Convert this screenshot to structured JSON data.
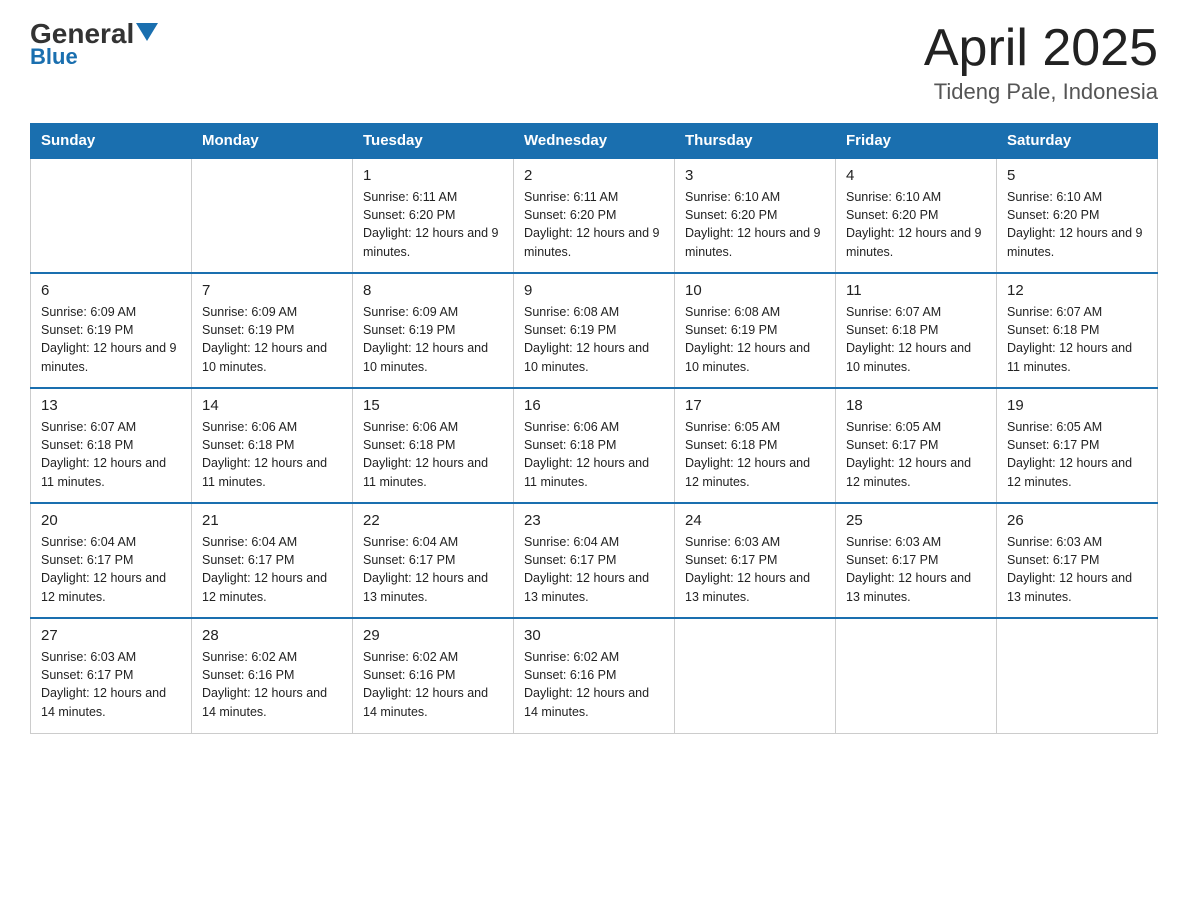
{
  "header": {
    "logo_general": "General",
    "logo_blue": "Blue",
    "month_title": "April 2025",
    "location": "Tideng Pale, Indonesia"
  },
  "columns": [
    "Sunday",
    "Monday",
    "Tuesday",
    "Wednesday",
    "Thursday",
    "Friday",
    "Saturday"
  ],
  "weeks": [
    [
      {
        "day": "",
        "sunrise": "",
        "sunset": "",
        "daylight": ""
      },
      {
        "day": "",
        "sunrise": "",
        "sunset": "",
        "daylight": ""
      },
      {
        "day": "1",
        "sunrise": "Sunrise: 6:11 AM",
        "sunset": "Sunset: 6:20 PM",
        "daylight": "Daylight: 12 hours and 9 minutes."
      },
      {
        "day": "2",
        "sunrise": "Sunrise: 6:11 AM",
        "sunset": "Sunset: 6:20 PM",
        "daylight": "Daylight: 12 hours and 9 minutes."
      },
      {
        "day": "3",
        "sunrise": "Sunrise: 6:10 AM",
        "sunset": "Sunset: 6:20 PM",
        "daylight": "Daylight: 12 hours and 9 minutes."
      },
      {
        "day": "4",
        "sunrise": "Sunrise: 6:10 AM",
        "sunset": "Sunset: 6:20 PM",
        "daylight": "Daylight: 12 hours and 9 minutes."
      },
      {
        "day": "5",
        "sunrise": "Sunrise: 6:10 AM",
        "sunset": "Sunset: 6:20 PM",
        "daylight": "Daylight: 12 hours and 9 minutes."
      }
    ],
    [
      {
        "day": "6",
        "sunrise": "Sunrise: 6:09 AM",
        "sunset": "Sunset: 6:19 PM",
        "daylight": "Daylight: 12 hours and 9 minutes."
      },
      {
        "day": "7",
        "sunrise": "Sunrise: 6:09 AM",
        "sunset": "Sunset: 6:19 PM",
        "daylight": "Daylight: 12 hours and 10 minutes."
      },
      {
        "day": "8",
        "sunrise": "Sunrise: 6:09 AM",
        "sunset": "Sunset: 6:19 PM",
        "daylight": "Daylight: 12 hours and 10 minutes."
      },
      {
        "day": "9",
        "sunrise": "Sunrise: 6:08 AM",
        "sunset": "Sunset: 6:19 PM",
        "daylight": "Daylight: 12 hours and 10 minutes."
      },
      {
        "day": "10",
        "sunrise": "Sunrise: 6:08 AM",
        "sunset": "Sunset: 6:19 PM",
        "daylight": "Daylight: 12 hours and 10 minutes."
      },
      {
        "day": "11",
        "sunrise": "Sunrise: 6:07 AM",
        "sunset": "Sunset: 6:18 PM",
        "daylight": "Daylight: 12 hours and 10 minutes."
      },
      {
        "day": "12",
        "sunrise": "Sunrise: 6:07 AM",
        "sunset": "Sunset: 6:18 PM",
        "daylight": "Daylight: 12 hours and 11 minutes."
      }
    ],
    [
      {
        "day": "13",
        "sunrise": "Sunrise: 6:07 AM",
        "sunset": "Sunset: 6:18 PM",
        "daylight": "Daylight: 12 hours and 11 minutes."
      },
      {
        "day": "14",
        "sunrise": "Sunrise: 6:06 AM",
        "sunset": "Sunset: 6:18 PM",
        "daylight": "Daylight: 12 hours and 11 minutes."
      },
      {
        "day": "15",
        "sunrise": "Sunrise: 6:06 AM",
        "sunset": "Sunset: 6:18 PM",
        "daylight": "Daylight: 12 hours and 11 minutes."
      },
      {
        "day": "16",
        "sunrise": "Sunrise: 6:06 AM",
        "sunset": "Sunset: 6:18 PM",
        "daylight": "Daylight: 12 hours and 11 minutes."
      },
      {
        "day": "17",
        "sunrise": "Sunrise: 6:05 AM",
        "sunset": "Sunset: 6:18 PM",
        "daylight": "Daylight: 12 hours and 12 minutes."
      },
      {
        "day": "18",
        "sunrise": "Sunrise: 6:05 AM",
        "sunset": "Sunset: 6:17 PM",
        "daylight": "Daylight: 12 hours and 12 minutes."
      },
      {
        "day": "19",
        "sunrise": "Sunrise: 6:05 AM",
        "sunset": "Sunset: 6:17 PM",
        "daylight": "Daylight: 12 hours and 12 minutes."
      }
    ],
    [
      {
        "day": "20",
        "sunrise": "Sunrise: 6:04 AM",
        "sunset": "Sunset: 6:17 PM",
        "daylight": "Daylight: 12 hours and 12 minutes."
      },
      {
        "day": "21",
        "sunrise": "Sunrise: 6:04 AM",
        "sunset": "Sunset: 6:17 PM",
        "daylight": "Daylight: 12 hours and 12 minutes."
      },
      {
        "day": "22",
        "sunrise": "Sunrise: 6:04 AM",
        "sunset": "Sunset: 6:17 PM",
        "daylight": "Daylight: 12 hours and 13 minutes."
      },
      {
        "day": "23",
        "sunrise": "Sunrise: 6:04 AM",
        "sunset": "Sunset: 6:17 PM",
        "daylight": "Daylight: 12 hours and 13 minutes."
      },
      {
        "day": "24",
        "sunrise": "Sunrise: 6:03 AM",
        "sunset": "Sunset: 6:17 PM",
        "daylight": "Daylight: 12 hours and 13 minutes."
      },
      {
        "day": "25",
        "sunrise": "Sunrise: 6:03 AM",
        "sunset": "Sunset: 6:17 PM",
        "daylight": "Daylight: 12 hours and 13 minutes."
      },
      {
        "day": "26",
        "sunrise": "Sunrise: 6:03 AM",
        "sunset": "Sunset: 6:17 PM",
        "daylight": "Daylight: 12 hours and 13 minutes."
      }
    ],
    [
      {
        "day": "27",
        "sunrise": "Sunrise: 6:03 AM",
        "sunset": "Sunset: 6:17 PM",
        "daylight": "Daylight: 12 hours and 14 minutes."
      },
      {
        "day": "28",
        "sunrise": "Sunrise: 6:02 AM",
        "sunset": "Sunset: 6:16 PM",
        "daylight": "Daylight: 12 hours and 14 minutes."
      },
      {
        "day": "29",
        "sunrise": "Sunrise: 6:02 AM",
        "sunset": "Sunset: 6:16 PM",
        "daylight": "Daylight: 12 hours and 14 minutes."
      },
      {
        "day": "30",
        "sunrise": "Sunrise: 6:02 AM",
        "sunset": "Sunset: 6:16 PM",
        "daylight": "Daylight: 12 hours and 14 minutes."
      },
      {
        "day": "",
        "sunrise": "",
        "sunset": "",
        "daylight": ""
      },
      {
        "day": "",
        "sunrise": "",
        "sunset": "",
        "daylight": ""
      },
      {
        "day": "",
        "sunrise": "",
        "sunset": "",
        "daylight": ""
      }
    ]
  ]
}
